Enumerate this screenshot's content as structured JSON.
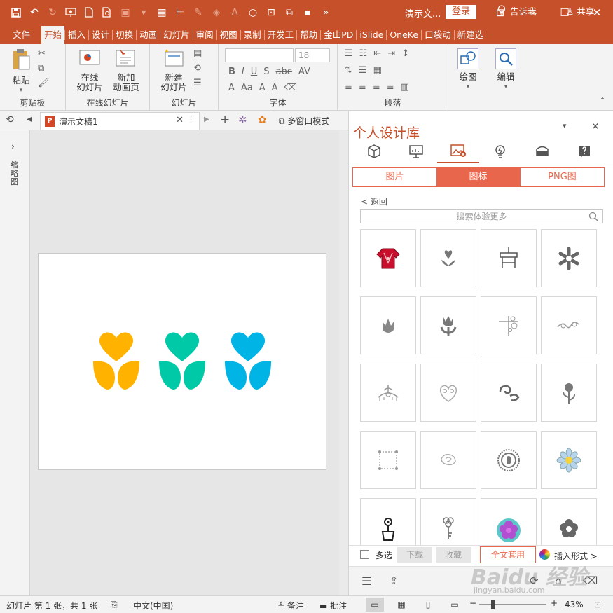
{
  "app": {
    "doc_title": "演示文...",
    "login_label": "登录",
    "window_buttons": [
      "restore-icon",
      "minimize-icon",
      "maximize-icon",
      "close-icon"
    ]
  },
  "tabs": [
    "文件",
    "开始",
    "插入",
    "设计",
    "切换",
    "动画",
    "幻灯片",
    "审阅",
    "视图",
    "录制",
    "开发工",
    "帮助",
    "金山PD",
    "iSlide",
    "OneKe",
    "口袋动",
    "新建选"
  ],
  "active_tab": "开始",
  "tell_me": "告诉我",
  "share": "共享",
  "ribbon": {
    "clipboard": {
      "paste": "粘贴",
      "group": "剪贴板"
    },
    "online": {
      "btn1_line1": "在线",
      "btn1_line2": "幻灯片",
      "btn2_line1": "新加",
      "btn2_line2": "动画页",
      "group": "在线幻灯片"
    },
    "slides": {
      "new_line1": "新建",
      "new_line2": "幻灯片",
      "group": "幻灯片"
    },
    "font": {
      "font_size": "18",
      "group": "字体"
    },
    "paragraph": {
      "group": "段落"
    },
    "drawing": {
      "label": "绘图"
    },
    "editing": {
      "label": "编辑"
    }
  },
  "doc_tab": {
    "name": "演示文稿1",
    "multi_window": "多窗口模式"
  },
  "side_pane": {
    "label": "缩略图"
  },
  "slide_icons_colors": [
    "#ffb300",
    "#00c9a7",
    "#00b4e6"
  ],
  "panel": {
    "title": "个人设计库",
    "seg_tabs": [
      "图片",
      "图标",
      "PNG图"
    ],
    "active_seg": "图标",
    "back": "< 返回",
    "search_placeholder": "搜索体验更多",
    "icons": [
      "red-sweater-icon",
      "heart-flower-icon",
      "table-candle-icon",
      "asterisk-flower-icon",
      "tulip-icon",
      "tulip-leaves-icon",
      "ornament-corner-icon",
      "swirl-ornament-icon",
      "crown-ornament-icon",
      "heart-ornament-icon",
      "spiral-ornament-icon",
      "rose-icon",
      "frame-ornament-icon",
      "rose-sketch-icon",
      "round-seal-icon",
      "daisy-icon",
      "flower-pot-icon",
      "key-clover-icon",
      "purple-flower-icon",
      "flower-outline-icon"
    ],
    "bottom": {
      "multi_select": "多选",
      "download": "下载",
      "collect": "收藏",
      "apply_all": "全文套用",
      "insert_form": "插入形式 >"
    }
  },
  "status": {
    "slide_info": "幻灯片 第 1 张，共 1 张",
    "language": "中文(中国)",
    "notes": "备注",
    "comments": "批注",
    "zoom": "43%"
  },
  "watermark": {
    "main": "Baidu 经验",
    "sub": "jingyan.baidu.com"
  }
}
